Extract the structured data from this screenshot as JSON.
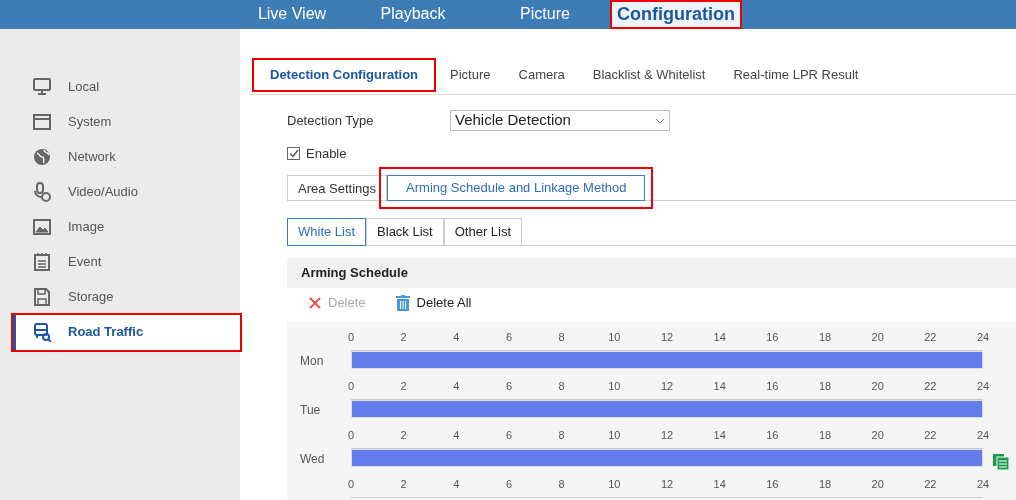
{
  "top_nav": [
    {
      "label": "Live View",
      "selected": false,
      "annotated": false
    },
    {
      "label": "Playback",
      "selected": false,
      "annotated": false
    },
    {
      "label": "Picture",
      "selected": false,
      "annotated": false
    },
    {
      "label": "Configuration",
      "selected": true,
      "annotated": true
    }
  ],
  "sidebar": {
    "items": [
      {
        "label": "Local",
        "selected": false,
        "annotated": false
      },
      {
        "label": "System",
        "selected": false,
        "annotated": false
      },
      {
        "label": "Network",
        "selected": false,
        "annotated": false
      },
      {
        "label": "Video/Audio",
        "selected": false,
        "annotated": false
      },
      {
        "label": "Image",
        "selected": false,
        "annotated": false
      },
      {
        "label": "Event",
        "selected": false,
        "annotated": false
      },
      {
        "label": "Storage",
        "selected": false,
        "annotated": false
      },
      {
        "label": "Road Traffic",
        "selected": true,
        "annotated": true
      }
    ]
  },
  "sub_tabs": [
    {
      "label": "Detection Configuration",
      "selected": true,
      "annotated": true
    },
    {
      "label": "Picture",
      "selected": false,
      "annotated": false
    },
    {
      "label": "Camera",
      "selected": false,
      "annotated": false
    },
    {
      "label": "Blacklist & Whitelist",
      "selected": false,
      "annotated": false
    },
    {
      "label": "Real-time LPR Result",
      "selected": false,
      "annotated": false
    }
  ],
  "detection_type": {
    "label": "Detection Type",
    "value": "Vehicle Detection"
  },
  "enable": {
    "label": "Enable",
    "checked": true
  },
  "steps": [
    {
      "label": "Area Settings",
      "selected": false,
      "annotated": false
    },
    {
      "label": "Arming Schedule and Linkage Method",
      "selected": true,
      "annotated": true
    }
  ],
  "list_tabs": [
    {
      "label": "White List",
      "selected": true
    },
    {
      "label": "Black List",
      "selected": false
    },
    {
      "label": "Other List",
      "selected": false
    }
  ],
  "schedule": {
    "title": "Arming Schedule",
    "actions": [
      {
        "label": "Delete",
        "kind": "delete",
        "disabled": true
      },
      {
        "label": "Delete All",
        "kind": "delete_all",
        "disabled": false
      }
    ],
    "days": [
      {
        "label": "Mon",
        "level": 1,
        "copy_icon": false,
        "ticks": [
          "0",
          "2",
          "4",
          "6",
          "8",
          "10",
          "12",
          "14",
          "16",
          "18",
          "20",
          "22",
          "24"
        ]
      },
      {
        "label": "Tue",
        "level": 1,
        "copy_icon": false,
        "ticks": [
          "0",
          "2",
          "4",
          "6",
          "8",
          "10",
          "12",
          "14",
          "16",
          "18",
          "20",
          "22",
          "24"
        ]
      },
      {
        "label": "Wed",
        "level": 1,
        "copy_icon": true,
        "ticks": [
          "0",
          "2",
          "4",
          "6",
          "8",
          "10",
          "12",
          "14",
          "16",
          "18",
          "20",
          "22",
          "24"
        ]
      },
      {
        "ticks": [
          "0",
          "2",
          "4",
          "6",
          "8",
          "10",
          "12",
          "14",
          "16",
          "18",
          "20",
          "22",
          "24"
        ]
      }
    ]
  }
}
